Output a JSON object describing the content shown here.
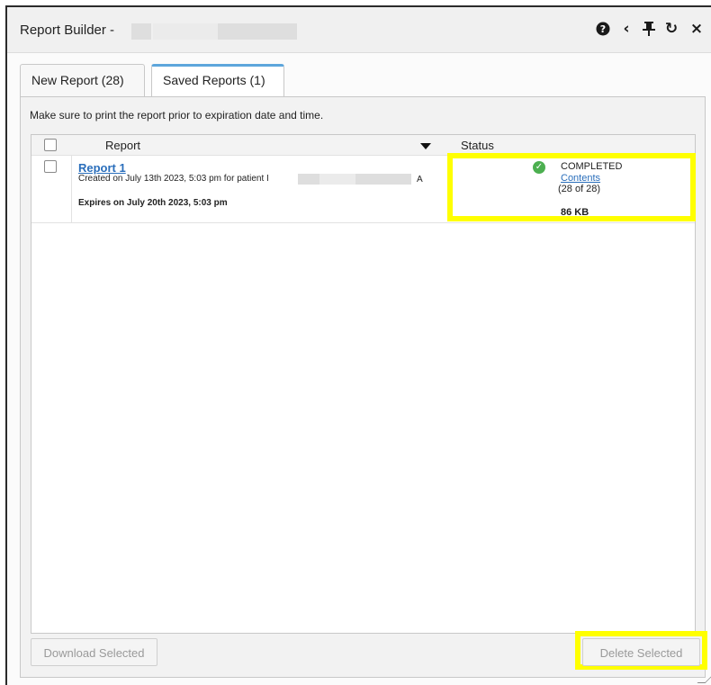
{
  "window": {
    "title": "Report Builder -",
    "icons": [
      "help-icon",
      "collapse-left-icon",
      "pin-icon",
      "refresh-icon",
      "close-icon"
    ],
    "icon_glyphs": {
      "help": "❓",
      "back": "‹",
      "pin": "☩",
      "refresh": "↻",
      "close": "×"
    }
  },
  "tabs": [
    {
      "label": "New Report (28)",
      "active": false
    },
    {
      "label": "Saved Reports (1)",
      "active": true
    }
  ],
  "notice": "Make sure to print the report prior to expiration date and time.",
  "table": {
    "columns": {
      "report": "Report",
      "status": "Status"
    },
    "rows": [
      {
        "title": "Report 1",
        "created": "Created on July 13th 2023, 5:03 pm for patient I",
        "created_suffix": "A",
        "expires": "Expires on July 20th 2023, 5:03 pm",
        "status": "COMPLETED",
        "contents_link": "Contents",
        "count": "(28 of 28)",
        "size": "86 KB"
      }
    ]
  },
  "buttons": {
    "download": "Download Selected",
    "delete": "Delete Selected"
  },
  "colors": {
    "highlight": "#ffff00",
    "link": "#2a6ebb",
    "active_tab": "#5da6dc",
    "success": "#4caf50"
  }
}
